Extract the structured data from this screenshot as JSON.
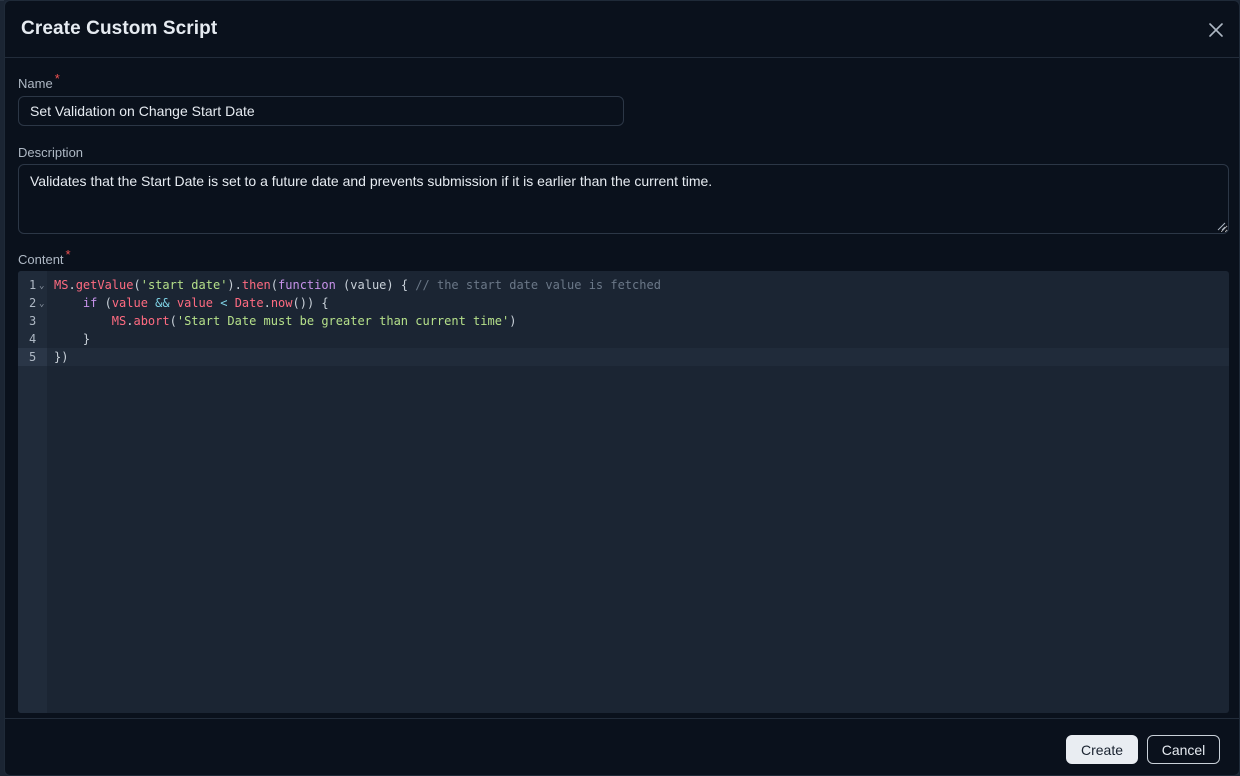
{
  "dialog": {
    "title": "Create Custom Script"
  },
  "form": {
    "name_label": "Name",
    "name_required": "*",
    "name_value": "Set Validation on Change Start Date",
    "description_label": "Description",
    "description_value": "Validates that the Start Date is set to a future date and prevents submission if it is earlier than the current time.",
    "content_label": "Content",
    "content_required": "*"
  },
  "editor": {
    "line_numbers": [
      "1",
      "2",
      "3",
      "4",
      "5"
    ],
    "lines": [
      "MS.getValue('start date').then(function (value) { // the start date value is fetched",
      "    if (value && value < Date.now()) {",
      "        MS.abort('Start Date must be greater than current time')",
      "    }",
      "})"
    ],
    "colors": {
      "identifier": "#ff6b81",
      "string": "#b5e08a",
      "keyword": "#c792ea",
      "comment": "#6b7888"
    }
  },
  "footer": {
    "create_label": "Create",
    "cancel_label": "Cancel"
  },
  "icons": {
    "close": "close-icon",
    "fold": "chevron-down-icon",
    "resize": "resize-handle-icon"
  }
}
